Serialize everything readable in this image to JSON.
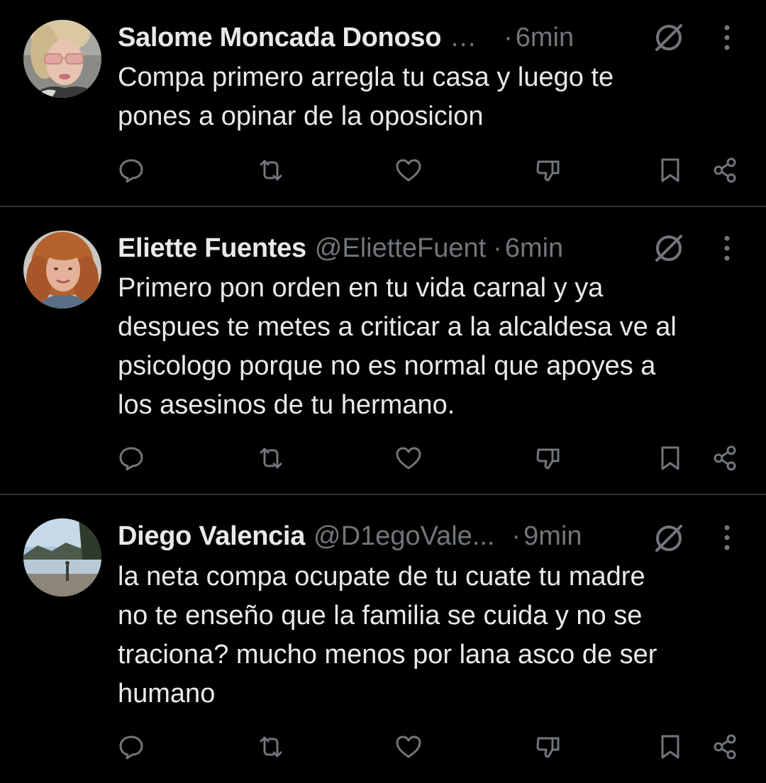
{
  "colors": {
    "background": "#000000",
    "text_primary": "#e7e9ea",
    "text_secondary": "#71767b",
    "divider": "#2f3336"
  },
  "replies": [
    {
      "author_name": "Salome Moncada Donoso",
      "handle": "…",
      "separator": "·",
      "time": "6min",
      "text_lines": [
        "Compa primero arregla tu casa y luego te",
        "pones a opinar de la oposicion"
      ],
      "avatar_icon": "avatar-woman-sunglasses"
    },
    {
      "author_name": "Eliette Fuentes",
      "handle": "@ElietteFuent",
      "separator": "·",
      "time": "6min",
      "text_lines": [
        "Primero pon orden en tu vida carnal y ya",
        "despues te metes a criticar a la alcaldesa ve al",
        "psicologo porque no es normal que apoyes a",
        "los asesinos de tu hermano."
      ],
      "avatar_icon": "avatar-woman-curly-hair"
    },
    {
      "author_name": "Diego Valencia",
      "handle": "@D1egoVale...",
      "separator": "·",
      "time": "9min",
      "text_lines": [
        "la neta compa ocupate de tu cuate tu madre",
        "no te enseño que la familia se cuida y no se",
        "traciona? mucho menos por lana asco de ser",
        "humano"
      ],
      "avatar_icon": "avatar-lake-landscape"
    }
  ],
  "action_icons": [
    "reply-icon",
    "repost-icon",
    "like-icon",
    "dislike-icon",
    "bookmark-icon",
    "share-icon"
  ],
  "header_icons": [
    "grok-icon",
    "more-options-icon"
  ]
}
